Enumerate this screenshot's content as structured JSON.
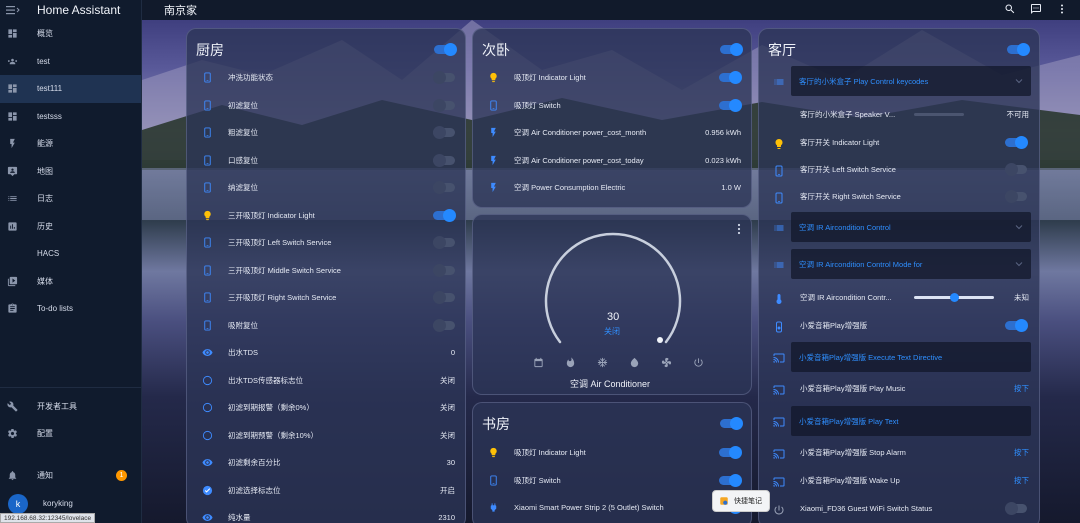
{
  "app": {
    "title": "Home Assistant"
  },
  "sidebar": {
    "items": [
      {
        "label": "概览",
        "icon": "dashboard-icon"
      },
      {
        "label": "test",
        "icon": "group-icon"
      },
      {
        "label": "test111",
        "icon": "dashboard-icon"
      },
      {
        "label": "testsss",
        "icon": "dashboard-icon"
      },
      {
        "label": "能源",
        "icon": "lightning-icon"
      },
      {
        "label": "地图",
        "icon": "map-icon"
      },
      {
        "label": "日志",
        "icon": "list-icon"
      },
      {
        "label": "历史",
        "icon": "chart-icon"
      },
      {
        "label": "HACS",
        "icon": "hacs-icon"
      },
      {
        "label": "媒体",
        "icon": "media-icon"
      },
      {
        "label": "To-do lists",
        "icon": "clipboard-icon"
      }
    ],
    "bottom": {
      "dev_tools": "开发者工具",
      "settings": "配置",
      "notifications": "通知",
      "notification_count": "1",
      "user_name": "koryking",
      "user_initial": "k"
    },
    "status_url": "192.168.68.32:12345/lovelace"
  },
  "topbar": {
    "title": "南京家"
  },
  "cards": {
    "kitchen": {
      "title": "厨房",
      "rows": [
        {
          "label": "冲洗功能状态",
          "type": "toggle",
          "state": "off"
        },
        {
          "label": "初滤复位",
          "type": "toggle",
          "state": "off"
        },
        {
          "label": "粗滤复位",
          "type": "toggle",
          "state": "off"
        },
        {
          "label": "口感复位",
          "type": "toggle",
          "state": "off"
        },
        {
          "label": "纳滤复位",
          "type": "toggle",
          "state": "off"
        },
        {
          "label": "三开吸顶灯 Indicator Light",
          "type": "toggle",
          "state": "on"
        },
        {
          "label": "三开吸顶灯 Left Switch Service",
          "type": "toggle",
          "state": "off"
        },
        {
          "label": "三开吸顶灯 Middle Switch Service",
          "type": "toggle",
          "state": "off"
        },
        {
          "label": "三开吸顶灯 Right Switch Service",
          "type": "toggle",
          "state": "off"
        },
        {
          "label": "吸附复位",
          "type": "toggle",
          "state": "off"
        },
        {
          "label": "出水TDS",
          "type": "value",
          "value": "0"
        },
        {
          "label": "出水TDS传感器标志位",
          "type": "value",
          "value": "关闭"
        },
        {
          "label": "初滤到期报警（剩余0%）",
          "type": "value",
          "value": "关闭"
        },
        {
          "label": "初滤到期预警（剩余10%）",
          "type": "value",
          "value": "关闭"
        },
        {
          "label": "初滤剩余百分比",
          "type": "value",
          "value": "30"
        },
        {
          "label": "初滤选择标志位",
          "type": "value",
          "value": "开启"
        },
        {
          "label": "纯水量",
          "type": "value",
          "value": "2310"
        }
      ]
    },
    "second_bedroom": {
      "title": "次卧",
      "rows": [
        {
          "label": "吸顶灯 Indicator Light",
          "type": "toggle",
          "state": "on"
        },
        {
          "label": "吸顶灯 Switch",
          "type": "toggle",
          "state": "on"
        },
        {
          "label": "空调 Air Conditioner power_cost_month",
          "type": "value",
          "value": "0.956 kWh"
        },
        {
          "label": "空调 Air Conditioner power_cost_today",
          "type": "value",
          "value": "0.023 kWh"
        },
        {
          "label": "空调 Power Consumption Electric",
          "type": "value",
          "value": "1.0 W"
        }
      ]
    },
    "thermostat": {
      "value": "30",
      "mode": "关闭",
      "name": "空调 Air Conditioner",
      "mode_icons": [
        "calendar-icon",
        "fire-icon",
        "snowflake-icon",
        "water-drop-icon",
        "fan-icon",
        "power-icon"
      ]
    },
    "study": {
      "title": "书房",
      "rows": [
        {
          "label": "吸顶灯 Indicator Light",
          "type": "toggle",
          "state": "on"
        },
        {
          "label": "吸顶灯 Switch",
          "type": "toggle",
          "state": "on"
        },
        {
          "label": "Xiaomi Smart Power Strip 2 (5 Outlet) Switch",
          "type": "toggle",
          "state": "on"
        }
      ]
    },
    "living_room": {
      "title": "客厅",
      "rows": [
        {
          "label": "客厅的小米盒子 Play Control keycodes",
          "type": "expander"
        },
        {
          "label": "客厅的小米盒子 Speaker V...",
          "type": "slider-value",
          "value": "不可用"
        },
        {
          "label": "客厅开关 Indicator Light",
          "type": "toggle",
          "state": "on"
        },
        {
          "label": "客厅开关 Left Switch Service",
          "type": "toggle",
          "state": "off"
        },
        {
          "label": "客厅开关 Right Switch Service",
          "type": "toggle",
          "state": "off"
        },
        {
          "label": "空调 IR Aircondition Control",
          "type": "expander"
        },
        {
          "label": "空调 IR Aircondition Control Mode for",
          "type": "expander"
        },
        {
          "label": "空调 IR Aircondition Contr...",
          "type": "slider-value",
          "value": "未知",
          "level": 0.5
        },
        {
          "label": "小爱音箱Play增强版",
          "type": "toggle",
          "state": "on"
        },
        {
          "label": "小爱音箱Play增强版 Execute Text Directive",
          "type": "text-input"
        },
        {
          "label": "小爱音箱Play增强版 Play Music",
          "type": "action",
          "value": "按下"
        },
        {
          "label": "小爱音箱Play增强版 Play Text",
          "type": "text-input"
        },
        {
          "label": "小爱音箱Play增强版 Stop Alarm",
          "type": "action",
          "value": "按下"
        },
        {
          "label": "小爱音箱Play增强版 Wake Up",
          "type": "action",
          "value": "按下"
        },
        {
          "label": "Xiaomi_FD36 Guest WiFi Switch Status",
          "type": "toggle",
          "state": "off"
        }
      ]
    }
  },
  "quick_note": {
    "label": "快捷笔记"
  },
  "colors": {
    "accent": "#2489ff",
    "card_bg": "rgba(43,52,86,0.78)",
    "sidebar_bg": "#101b2d"
  }
}
